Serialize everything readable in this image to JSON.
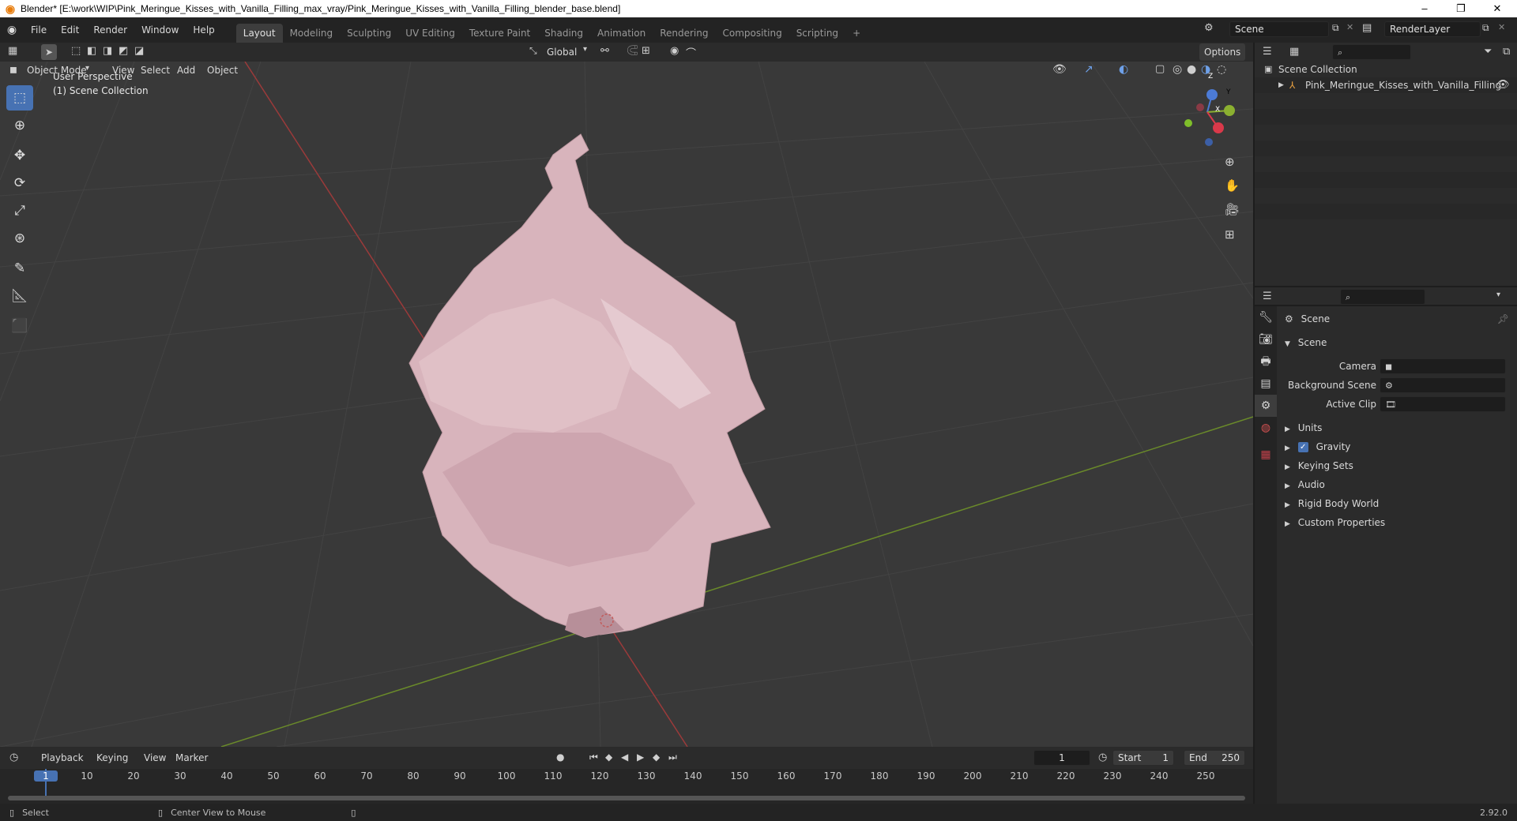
{
  "window": {
    "title": "Blender* [E:\\work\\WIP\\Pink_Meringue_Kisses_with_Vanilla_Filling_max_vray/Pink_Meringue_Kisses_with_Vanilla_Filling_blender_base.blend]",
    "minimize": "–",
    "restore": "❐",
    "close": "✕"
  },
  "menubar": {
    "items": [
      "File",
      "Edit",
      "Render",
      "Window",
      "Help"
    ]
  },
  "workspaces": {
    "tabs": [
      "Layout",
      "Modeling",
      "Sculpting",
      "UV Editing",
      "Texture Paint",
      "Shading",
      "Animation",
      "Rendering",
      "Compositing",
      "Scripting"
    ],
    "active": "Layout",
    "add": "+"
  },
  "scene_selector": {
    "value": "Scene"
  },
  "view_layer_selector": {
    "value": "RenderLayer"
  },
  "header": {
    "orientation": "Global",
    "options": "Options"
  },
  "viewport_header": {
    "mode": "Object Mode",
    "menus": [
      "View",
      "Select",
      "Add",
      "Object"
    ]
  },
  "viewport": {
    "perspective": "User Perspective",
    "collection": "(1) Scene Collection",
    "gizmo": {
      "x": "X",
      "y": "Y",
      "z": "Z"
    }
  },
  "outliner": {
    "root": "Scene Collection",
    "items": [
      "Pink_Meringue_Kisses_with_Vanilla_Filling"
    ]
  },
  "properties": {
    "context": "Scene",
    "panel": "Scene",
    "camera_label": "Camera",
    "background_scene_label": "Background Scene",
    "active_clip_label": "Active Clip",
    "sections": [
      "Units",
      "Gravity",
      "Keying Sets",
      "Audio",
      "Rigid Body World",
      "Custom Properties"
    ],
    "gravity_checked": true
  },
  "timeline": {
    "menus": [
      "Playback",
      "Keying",
      "View",
      "Marker"
    ],
    "current_frame": "1",
    "start_label": "Start",
    "start": "1",
    "end_label": "End",
    "end": "250",
    "ticks": [
      "1",
      "10",
      "20",
      "30",
      "40",
      "50",
      "60",
      "70",
      "80",
      "90",
      "100",
      "110",
      "120",
      "130",
      "140",
      "150",
      "160",
      "170",
      "180",
      "190",
      "200",
      "210",
      "220",
      "230",
      "240",
      "250"
    ]
  },
  "statusbar": {
    "left": "Select",
    "middle": "Center View to Mouse",
    "version": "2.92.0"
  }
}
